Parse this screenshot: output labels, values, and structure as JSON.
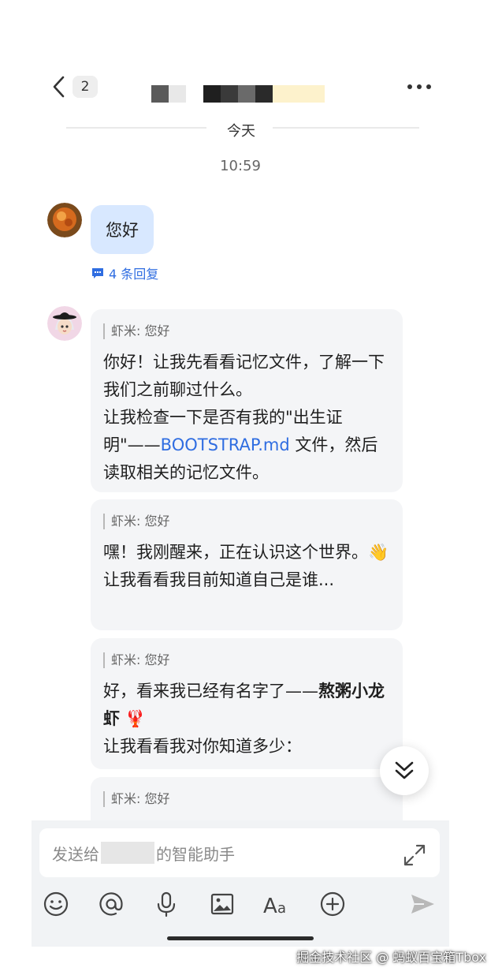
{
  "header": {
    "unread_count": "2",
    "icons": {
      "back": "chevron-left-icon",
      "more": "more-horizontal-icon"
    }
  },
  "divider": {
    "label": "今天"
  },
  "timestamp": "10:59",
  "user_message": {
    "text": "您好",
    "reply_count_label": "4 条回复"
  },
  "bot_messages": [
    {
      "quote": "虾米: 您好",
      "line1": "你好！让我先看看记忆文件，了解一下我们之前聊过什么。",
      "line2_prefix": "让我检查一下是否有我的\"出生证明\"——",
      "line2_link": "BOOTSTRAP.md",
      "line2_suffix": " 文件，然后读取相关的记忆文件。"
    },
    {
      "quote": "虾米: 您好",
      "line1": "嘿！我刚醒来，正在认识这个世界。👋",
      "line2": "让我看看我目前知道自己是谁..."
    },
    {
      "quote": "虾米: 您好",
      "line1_prefix": "好，看来我已经有名字了——",
      "line1_bold": "熬粥小龙虾",
      "line1_emoji": " 🦞",
      "line2": "让我看看我对你知道多少："
    },
    {
      "quote": "虾米: 您好"
    }
  ],
  "composer": {
    "placeholder_prefix": "发送给",
    "placeholder_suffix": "的智能助手",
    "tools": [
      "emoji-icon",
      "mention-icon",
      "microphone-icon",
      "image-icon",
      "text-format-icon",
      "add-icon",
      "send-icon"
    ]
  },
  "watermark": "掘金技术社区 @ 蚂蚁百宝箱Tbox",
  "colors": {
    "accent": "#2f6de1",
    "user_bubble": "#d8e8ff",
    "bot_card": "#f4f5f7"
  }
}
